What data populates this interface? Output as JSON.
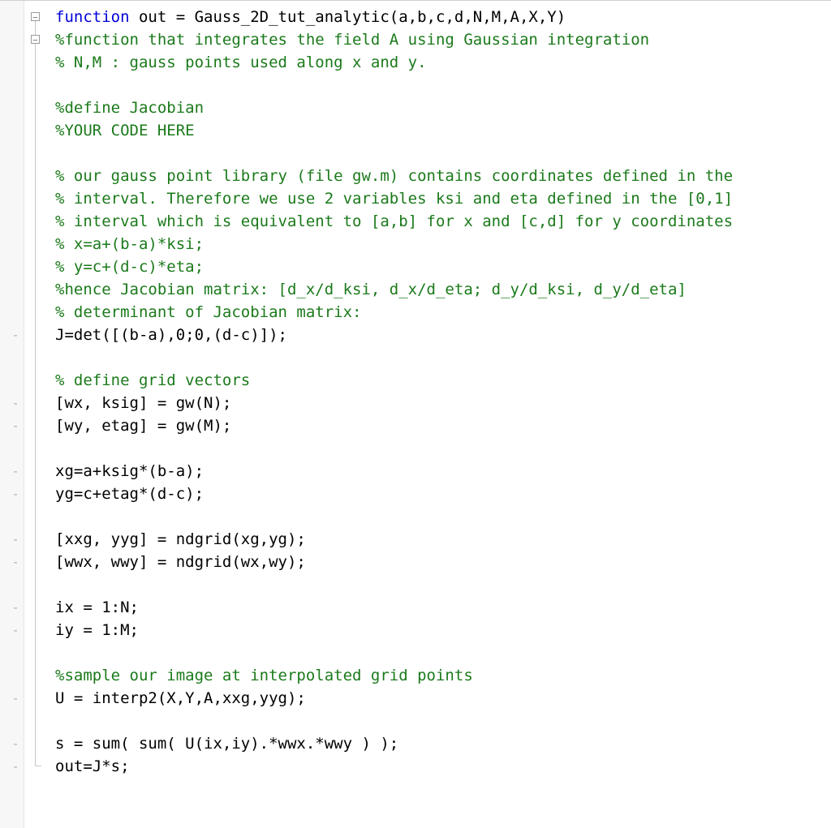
{
  "gutter_glyph": "-",
  "lines": [
    {
      "num": "",
      "fold": "box-start",
      "mark": "",
      "segments": [
        {
          "cls": "kw",
          "t": "function "
        },
        {
          "cls": "",
          "t": "out = Gauss_2D_tut_analytic(a,b,c,d,N,M,A,X,Y)"
        }
      ]
    },
    {
      "num": "",
      "fold": "box-mid",
      "mark": "",
      "segments": [
        {
          "cls": "cm",
          "t": "%function that integrates the field A using Gaussian integration"
        }
      ]
    },
    {
      "num": "",
      "fold": "line",
      "mark": "",
      "segments": [
        {
          "cls": "cm",
          "t": "% N,M : gauss points used along x and y."
        }
      ]
    },
    {
      "num": "",
      "fold": "line",
      "mark": "",
      "segments": []
    },
    {
      "num": "",
      "fold": "line",
      "mark": "",
      "segments": [
        {
          "cls": "cm",
          "t": "%define Jacobian"
        }
      ]
    },
    {
      "num": "",
      "fold": "line",
      "mark": "",
      "segments": [
        {
          "cls": "cm",
          "t": "%YOUR CODE HERE"
        }
      ]
    },
    {
      "num": "",
      "fold": "line",
      "mark": "",
      "segments": []
    },
    {
      "num": "",
      "fold": "line",
      "mark": "",
      "segments": [
        {
          "cls": "cm",
          "t": "% our gauss point library (file gw.m) contains coordinates defined in the"
        }
      ]
    },
    {
      "num": "",
      "fold": "line",
      "mark": "",
      "segments": [
        {
          "cls": "cm",
          "t": "% interval. Therefore we use 2 variables ksi and eta defined in the [0,1]"
        }
      ]
    },
    {
      "num": "",
      "fold": "line",
      "mark": "",
      "segments": [
        {
          "cls": "cm",
          "t": "% interval which is equivalent to [a,b] for x and [c,d] for y coordinates"
        }
      ]
    },
    {
      "num": "",
      "fold": "line",
      "mark": "",
      "segments": [
        {
          "cls": "cm",
          "t": "% x=a+(b-a)*ksi;"
        }
      ]
    },
    {
      "num": "",
      "fold": "line",
      "mark": "",
      "segments": [
        {
          "cls": "cm",
          "t": "% y=c+(d-c)*eta;"
        }
      ]
    },
    {
      "num": "",
      "fold": "line",
      "mark": "",
      "segments": [
        {
          "cls": "cm",
          "t": "%hence Jacobian matrix: [d_x/d_ksi, d_x/d_eta; d_y/d_ksi, d_y/d_eta]"
        }
      ]
    },
    {
      "num": "",
      "fold": "line",
      "mark": "",
      "segments": [
        {
          "cls": "cm",
          "t": "% determinant of Jacobian matrix:"
        }
      ]
    },
    {
      "num": "",
      "fold": "line",
      "mark": "dash",
      "segments": [
        {
          "cls": "",
          "t": "J=det([(b-a),0;0,(d-c)]);"
        }
      ]
    },
    {
      "num": "",
      "fold": "line",
      "mark": "",
      "segments": []
    },
    {
      "num": "",
      "fold": "line",
      "mark": "",
      "segments": [
        {
          "cls": "cm",
          "t": "% define grid vectors"
        }
      ]
    },
    {
      "num": "",
      "fold": "line",
      "mark": "dash",
      "segments": [
        {
          "cls": "",
          "t": "[wx, ksig] = gw(N);"
        }
      ]
    },
    {
      "num": "",
      "fold": "line",
      "mark": "dash",
      "segments": [
        {
          "cls": "",
          "t": "[wy, etag] = gw(M);"
        }
      ]
    },
    {
      "num": "",
      "fold": "line",
      "mark": "",
      "segments": []
    },
    {
      "num": "",
      "fold": "line",
      "mark": "dash",
      "segments": [
        {
          "cls": "",
          "t": "xg=a+ksig*(b-a);"
        }
      ]
    },
    {
      "num": "",
      "fold": "line",
      "mark": "dash",
      "segments": [
        {
          "cls": "",
          "t": "yg=c+etag*(d-c);"
        }
      ]
    },
    {
      "num": "",
      "fold": "line",
      "mark": "",
      "segments": []
    },
    {
      "num": "",
      "fold": "line",
      "mark": "dash",
      "segments": [
        {
          "cls": "",
          "t": "[xxg, yyg] = ndgrid(xg,yg);"
        }
      ]
    },
    {
      "num": "",
      "fold": "line",
      "mark": "dash",
      "segments": [
        {
          "cls": "",
          "t": "[wwx, wwy] = ndgrid(wx,wy);"
        }
      ]
    },
    {
      "num": "",
      "fold": "line",
      "mark": "",
      "segments": []
    },
    {
      "num": "",
      "fold": "line",
      "mark": "dash",
      "segments": [
        {
          "cls": "",
          "t": "ix = 1:N;"
        }
      ]
    },
    {
      "num": "",
      "fold": "line",
      "mark": "dash",
      "segments": [
        {
          "cls": "",
          "t": "iy = 1:M;"
        }
      ]
    },
    {
      "num": "",
      "fold": "line",
      "mark": "",
      "segments": []
    },
    {
      "num": "",
      "fold": "line",
      "mark": "",
      "segments": [
        {
          "cls": "cm",
          "t": "%sample our image at interpolated grid points"
        }
      ]
    },
    {
      "num": "",
      "fold": "line",
      "mark": "dash",
      "segments": [
        {
          "cls": "",
          "t": "U = interp2(X,Y,A,xxg,yyg);"
        }
      ]
    },
    {
      "num": "",
      "fold": "line",
      "mark": "",
      "segments": []
    },
    {
      "num": "",
      "fold": "line",
      "mark": "dash",
      "segments": [
        {
          "cls": "",
          "t": "s = sum( sum( U(ix,iy).*wwx.*wwy ) );"
        }
      ]
    },
    {
      "num": "",
      "fold": "end",
      "mark": "dash",
      "segments": [
        {
          "cls": "",
          "t": "out=J*s;"
        }
      ]
    },
    {
      "num": "",
      "fold": "",
      "mark": "",
      "segments": []
    },
    {
      "num": "",
      "fold": "",
      "mark": "",
      "segments": []
    }
  ]
}
